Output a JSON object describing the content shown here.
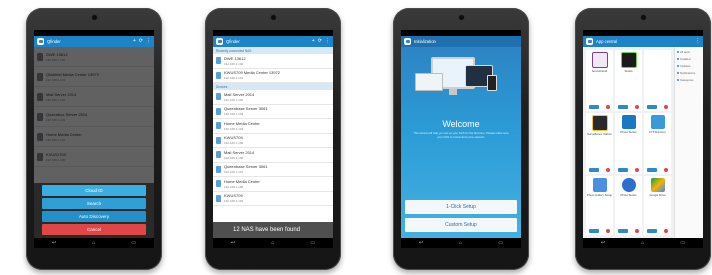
{
  "screen1": {
    "status": {
      "left": "",
      "right": ""
    },
    "title": "Qfinder",
    "nas_list": [
      {
        "name": "DWE 13612",
        "ip": "192.168.1.100"
      },
      {
        "name": "Qlinkfeld Media Center 13972",
        "ip": "192.168.1.101"
      },
      {
        "name": "Mail Server 2014",
        "ip": "192.168.1.102"
      },
      {
        "name": "Queenbox Server 2014",
        "ip": "192.168.1.103"
      },
      {
        "name": "Home Media Center",
        "ip": "192.168.1.104"
      },
      {
        "name": "KVUS1709",
        "ip": "192.168.1.105"
      }
    ],
    "sheet": {
      "cloud_id": "Cloud ID",
      "search": "Search",
      "auto_discovery": "Auto Discovery",
      "cancel": "Cancel"
    }
  },
  "screen2": {
    "title": "Qfinder",
    "section_connected": "Recently connected NAS",
    "connected": [
      {
        "name": "DWE 13612",
        "ip": "192.168.1.100"
      },
      {
        "name": "KWUS709 Media Center 13972",
        "ip": "192.168.1.101"
      }
    ],
    "section_devices": "Devices",
    "devices": [
      {
        "name": "Mail Server 2014",
        "ip": "192.168.1.102"
      },
      {
        "name": "Queenbase Server 3061",
        "ip": "192.168.1.103"
      },
      {
        "name": "Home Media Center",
        "ip": "192.168.1.104"
      },
      {
        "name": "KWUS709",
        "ip": "192.168.1.105"
      },
      {
        "name": "Mail Server 2014",
        "ip": "192.168.1.106"
      },
      {
        "name": "Queenbase Server 3061",
        "ip": "192.168.1.107"
      },
      {
        "name": "Home Media Center",
        "ip": "192.168.1.108"
      },
      {
        "name": "KWUS709",
        "ip": "192.168.1.109"
      }
    ],
    "toast": "12 NAS have been found"
  },
  "screen3": {
    "title": "Initialization",
    "welcome": "Welcome",
    "subtitle": "This wizard will help you set up your NAS for the first time. Please make sure your NAS is connected to the network.",
    "one_click": "1-Click Setup",
    "custom": "Custom Setup"
  },
  "screen4": {
    "title": "App central",
    "apps": [
      {
        "name": "SoundCloud",
        "color": "#f0e9f3",
        "accent": "#7a3f96"
      },
      {
        "name": "Studio",
        "color": "#1b1b1b",
        "accent": "#6bd04b"
      },
      {
        "name": "",
        "color": "#ffffff",
        "accent": "#ffffff"
      },
      {
        "name": "Surveillance Station",
        "color": "#2a2a2a",
        "accent": "#f3c53b"
      },
      {
        "name": "Photo Series",
        "color": "#1a77c4",
        "accent": "#ffffff"
      },
      {
        "name": "FTP Explorer",
        "color": "#3a9ad9",
        "accent": "#ffffff"
      },
      {
        "name": "Photo Gallery Setup",
        "color": "#ffffff",
        "accent": "#4a90e2"
      },
      {
        "name": "Photo Series",
        "color": "#ffffff",
        "accent": "#2d6fd0"
      },
      {
        "name": "Google Drive",
        "color": "#ffffff",
        "accent": "#f4b400"
      }
    ],
    "side_items": [
      "All apps",
      "Installed",
      "Updates",
      "Notifications",
      "Categories"
    ]
  }
}
